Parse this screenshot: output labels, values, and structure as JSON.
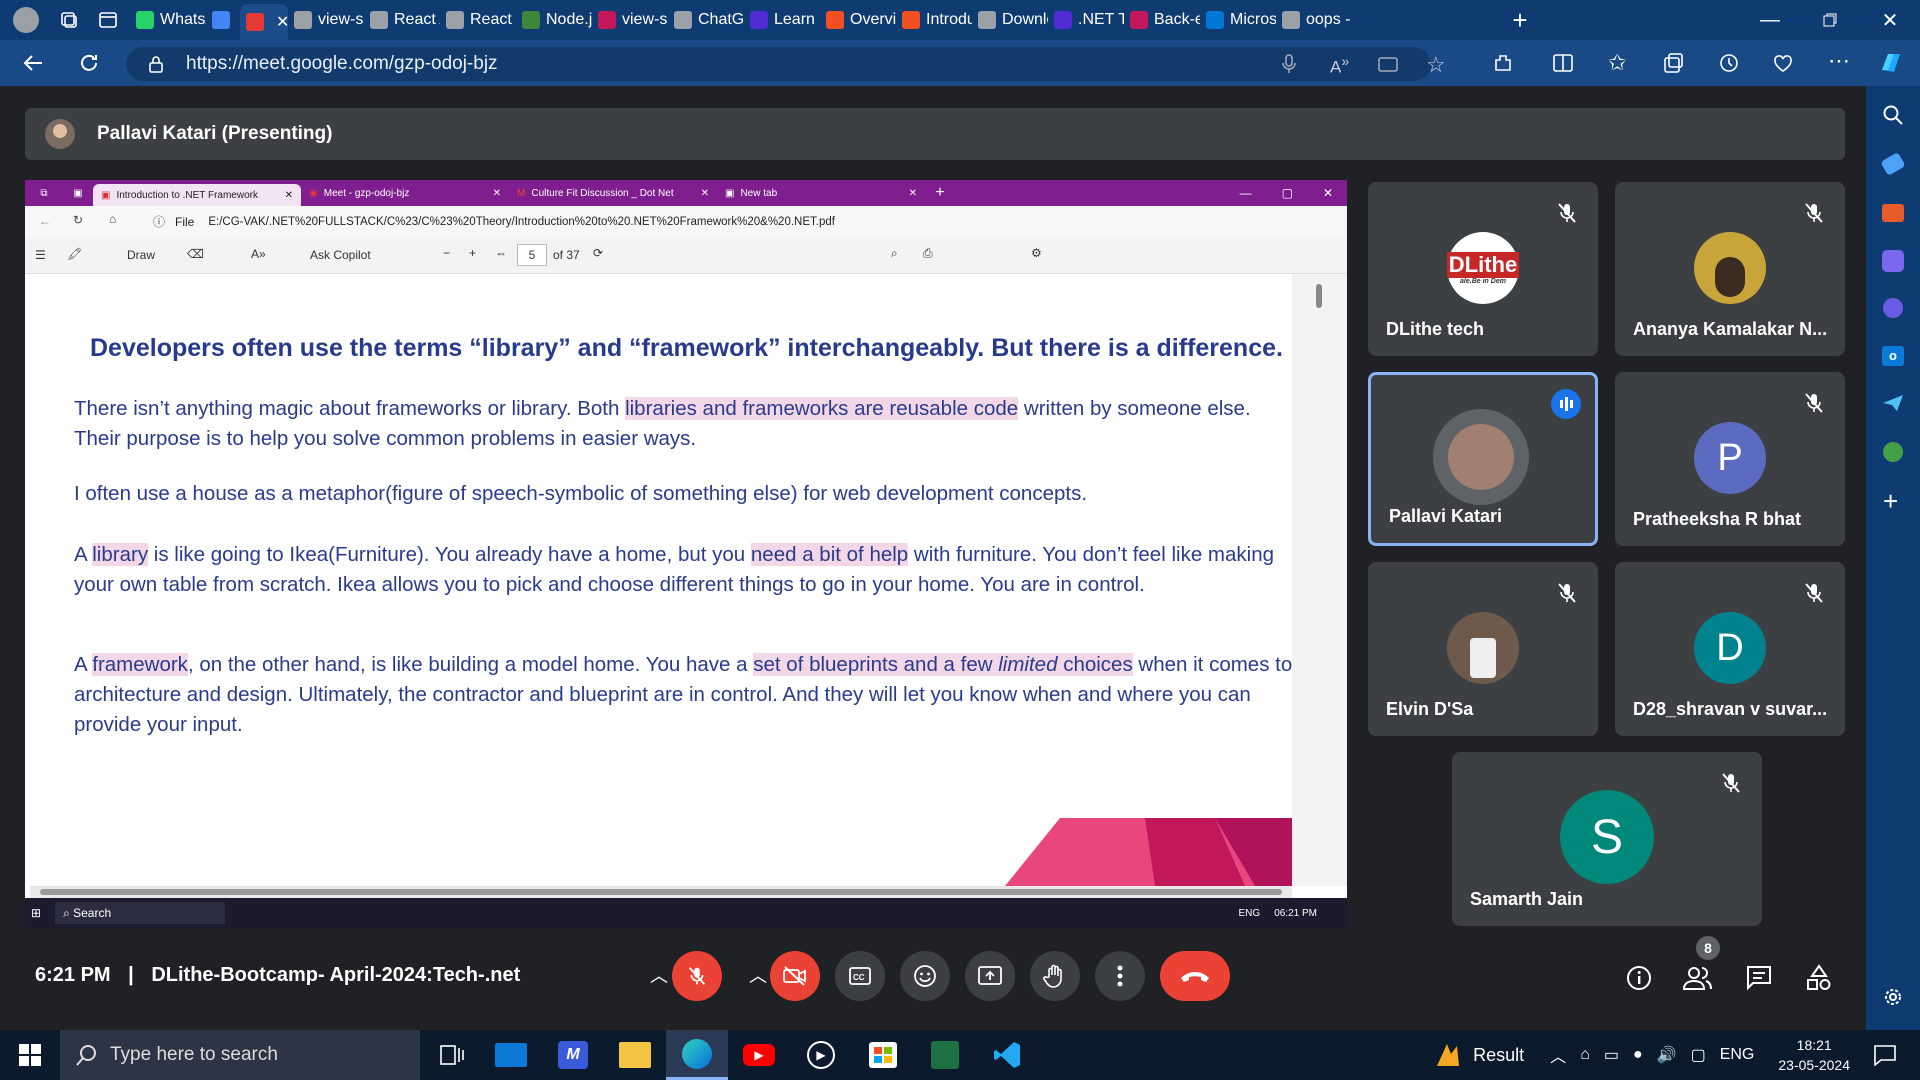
{
  "browser": {
    "tabs": [
      {
        "label": "WhatsA",
        "color": "#25d366"
      },
      {
        "label": "",
        "color": "#4285f4"
      },
      {
        "label": "",
        "color": "#e53935"
      },
      {
        "label": "view-so",
        "color": "#9aa0a6"
      },
      {
        "label": "React A",
        "color": "#9aa0a6"
      },
      {
        "label": "React",
        "color": "#9aa0a6"
      },
      {
        "label": "Node.js",
        "color": "#3c873a"
      },
      {
        "label": "view-so",
        "color": "#c2185b"
      },
      {
        "label": "ChatGP",
        "color": "#9aa0a6"
      },
      {
        "label": "Learn b",
        "color": "#512bd4"
      },
      {
        "label": "Overvie",
        "color": "#f25022"
      },
      {
        "label": "Introdu",
        "color": "#f25022"
      },
      {
        "label": "Downlo",
        "color": "#9aa0a6"
      },
      {
        "label": ".NET Tu",
        "color": "#512bd4"
      },
      {
        "label": "Back-er",
        "color": "#c2185b"
      },
      {
        "label": "Microso",
        "color": "#0078d4"
      },
      {
        "label": "oops -",
        "color": "#9aa0a6"
      }
    ],
    "url": "https://meet.google.com/gzp-odoj-bjz"
  },
  "meet": {
    "presenter_label": "Pallavi Katari (Presenting)",
    "time": "6:21 PM",
    "separator": "|",
    "meeting_title": "DLithe-Bootcamp- April-2024:Tech-.net",
    "participant_count": "8",
    "participants": [
      {
        "name": "DLithe tech",
        "logo_text": "DLithe",
        "logo_sub": "ale.Be in Dem"
      },
      {
        "name": "Ananya Kamalakar N..."
      },
      {
        "name": "Pallavi Katari"
      },
      {
        "name": "Pratheeksha R bhat",
        "initial": "P"
      },
      {
        "name": "Elvin D'Sa"
      },
      {
        "name": "D28_shravan v suvar...",
        "initial": "D"
      },
      {
        "name": "Samarth Jain",
        "initial": "S"
      }
    ]
  },
  "shared": {
    "tabs": [
      "Introduction to .NET Framework",
      "Meet - gzp-odoj-bjz",
      "Culture Fit Discussion _ Dot Net",
      "New tab"
    ],
    "file_label": "File",
    "path": "E:/CG-VAK/.NET%20FULLSTACK/C%23/C%23%20Theory/Introduction%20to%20.NET%20Framework%20&%20.NET.pdf",
    "toolbar": {
      "draw": "Draw",
      "copilot": "Ask Copilot",
      "page": "5",
      "of": "of 37"
    },
    "taskbar": {
      "search": "Search",
      "lang": "ENG",
      "time": "06:21 PM"
    },
    "pdf": {
      "heading": "Developers often use the terms “library” and “framework” interchangeably. But there is a difference.",
      "p1": {
        "a": "There isn’t anything magic about frameworks or library. Both ",
        "h": "libraries and frameworks are reusable code",
        "b": " written by someone else. Their purpose is to help you solve common problems in easier ways."
      },
      "p2": "I often use a house as a metaphor(figure of speech-symbolic of something else) for web development concepts.",
      "p3": {
        "a": "A ",
        "h1": "library",
        "b": " is like going to Ikea(Furniture). You already have a home, but you ",
        "h2": "need a bit of help",
        "c": " with furniture. You don’t feel like making your own table from scratch. Ikea allows you to pick and choose different things to go in your home. You are in control."
      },
      "p4": {
        "a": "A ",
        "h1": "framework",
        "b": ", on the other hand, is like building a model home. You have a ",
        "h2a": "set of blueprints and a few ",
        "h2b": "limited",
        "h2c": " choices",
        "c": " when it comes to architecture and design. Ultimately, the contractor and blueprint are in control. And they will let you know when and where you can provide your input."
      }
    }
  },
  "taskbar": {
    "search_placeholder": "Type here to search",
    "weather": "Result",
    "lang": "ENG",
    "time": "18:21",
    "date": "23-05-2024"
  }
}
